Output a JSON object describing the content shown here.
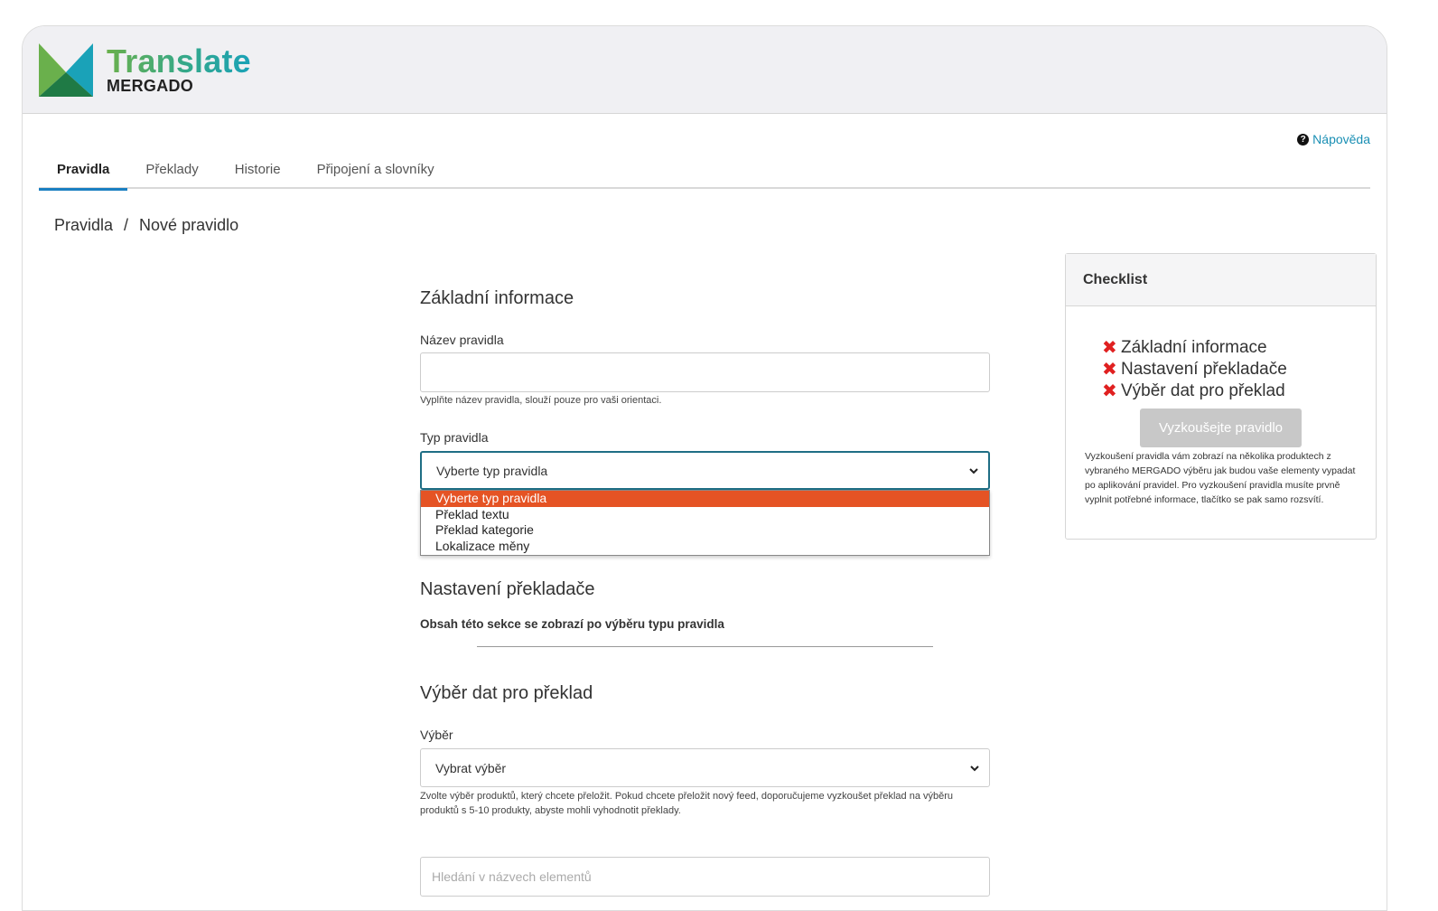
{
  "brand": {
    "title": "Translate",
    "subtitle": "MERGADO",
    "colors": {
      "green": "#6ab04c",
      "teal": "#1aa2b8",
      "dark_green": "#1f7a45",
      "accent": "#1a7fc1",
      "highlight": "#e55324"
    }
  },
  "header": {
    "help_label": "Nápověda",
    "help_icon": "question-circle-icon"
  },
  "tabs": [
    {
      "label": "Pravidla",
      "active": true
    },
    {
      "label": "Překlady",
      "active": false
    },
    {
      "label": "Historie",
      "active": false
    },
    {
      "label": "Připojení a slovníky",
      "active": false
    }
  ],
  "breadcrumb": {
    "items": [
      "Pravidla",
      "Nové pravidlo"
    ],
    "separator": "/"
  },
  "form": {
    "basic_title": "Základní informace",
    "name_label": "Název pravidla",
    "name_value": "",
    "name_help": "Vyplňte název pravidla, slouží pouze pro vaši orientaci.",
    "type_label": "Typ pravidla",
    "type_selected": "Vyberte typ pravidla",
    "type_options": [
      "Vyberte typ pravidla",
      "Překlad textu",
      "Překlad kategorie",
      "Lokalizace měny"
    ],
    "translator_title": "Nastavení překladače",
    "translator_note": "Obsah této sekce se zobrazí po výběru typu pravidla",
    "data_title": "Výběr dat pro překlad",
    "selection_label": "Výběr",
    "selection_value": "Vybrat výběr",
    "selection_help": "Zvolte výběr produktů, který chcete přeložit. Pokud chcete přeložit nový feed, doporučujeme vyzkoušet překlad na výběru produktů s 5-10 produkty, abyste mohli vyhodnotit překlady.",
    "search_placeholder": "Hledání v názvech elementů"
  },
  "checklist": {
    "title": "Checklist",
    "items": [
      "Základní informace",
      "Nastavení překladače",
      "Výběr dat pro překlad"
    ],
    "item_icon": "x-mark-icon",
    "button_label": "Vyzkoušejte pravidlo",
    "note": "Vyzkoušení pravidla vám zobrazí na několika produktech z vybraného MERGADO výběru jak budou vaše elementy vypadat po aplikování pravidel. Pro vyzkoušení pravidla musíte prvně vyplnit potřebné informace, tlačítko se pak samo rozsvítí."
  }
}
